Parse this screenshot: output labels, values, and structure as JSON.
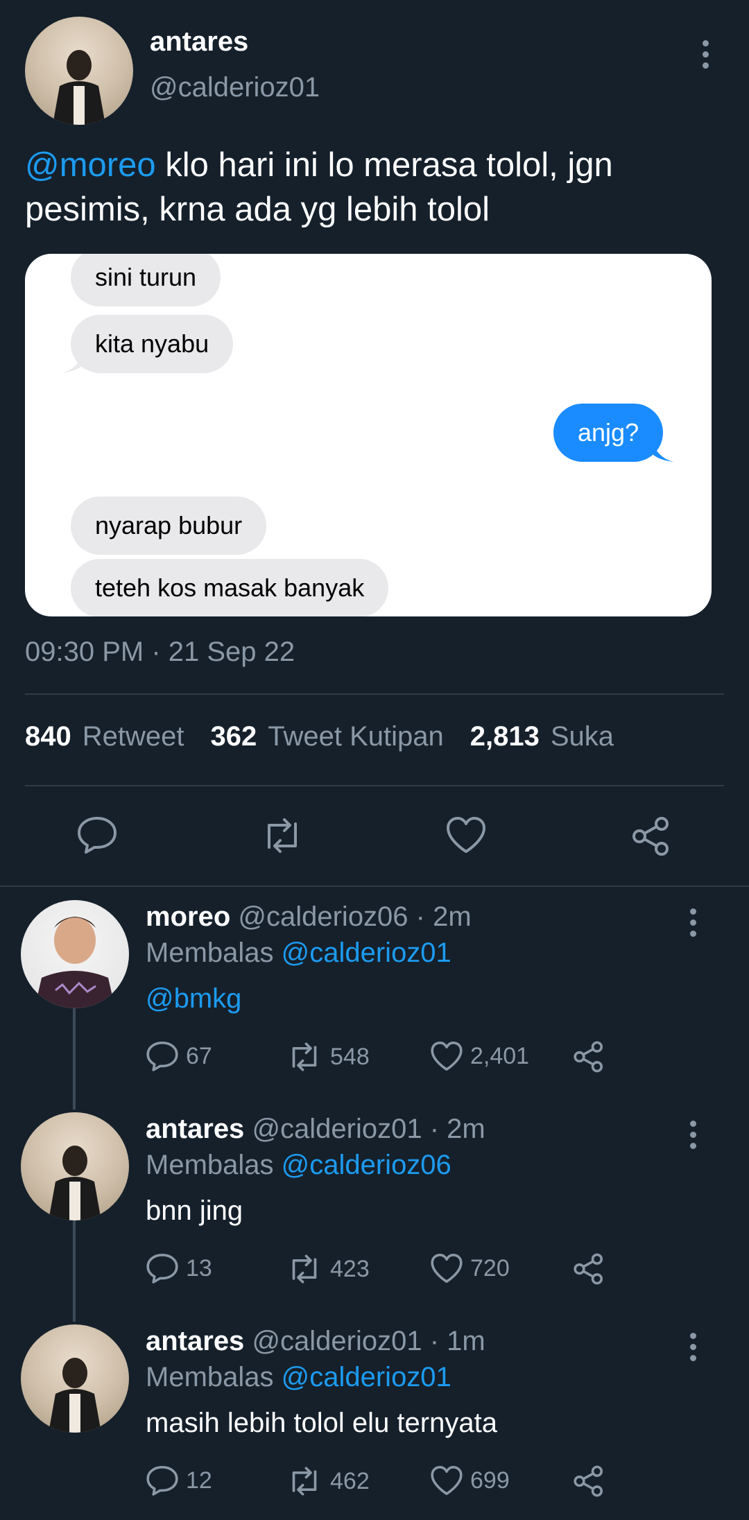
{
  "tweet": {
    "name": "antares",
    "handle": "@calderioz01",
    "mention": "@moreo",
    "text_line1": " klo hari ini lo merasa tolol, jgn",
    "text_line2": "pesimis, krna ada yg lebih tolol",
    "timestamp": "09:30 PM · 21 Sep 22"
  },
  "chat_image": {
    "messages": [
      {
        "side": "in",
        "text": "sini turun"
      },
      {
        "side": "in",
        "text": "kita nyabu"
      },
      {
        "side": "out",
        "text": "anjg?"
      },
      {
        "side": "in",
        "text": "nyarap bubur"
      },
      {
        "side": "in",
        "text": "teteh kos masak banyak"
      }
    ]
  },
  "stats": {
    "retweets": "840",
    "retweets_label": "Retweet",
    "quotes": "362",
    "quotes_label": "Tweet Kutipan",
    "likes": "2,813",
    "likes_label": "Suka"
  },
  "replies": [
    {
      "name": "moreo",
      "handle": "@calderioz06",
      "time": " · 2m",
      "replying_label": "Membalas ",
      "replying_to": "@calderioz01",
      "body": "@bmkg",
      "body_is_link": true,
      "comments": "67",
      "retweets": "548",
      "likes": "2,401"
    },
    {
      "name": "antares",
      "handle": "@calderioz01",
      "time": " · 2m",
      "replying_label": "Membalas ",
      "replying_to": "@calderioz06",
      "body": "bnn jing",
      "body_is_link": false,
      "comments": "13",
      "retweets": "423",
      "likes": "720"
    },
    {
      "name": "antares",
      "handle": "@calderioz01",
      "time": " · 1m",
      "replying_label": "Membalas ",
      "replying_to": "@calderioz01",
      "body": "masih lebih tolol elu ternyata",
      "body_is_link": false,
      "comments": "12",
      "retweets": "462",
      "likes": "699"
    }
  ],
  "icons": {
    "reply": "speech-bubble-icon",
    "retweet": "retweet-arrows-icon",
    "like": "heart-outline-icon",
    "share": "share-nodes-icon",
    "more": "vertical-dots-icon"
  },
  "colors": {
    "background": "#15202b",
    "link": "#1d9bf0",
    "muted": "#8b98a5",
    "bubble_out": "#1a8cff",
    "bubble_in": "#e9e9eb"
  }
}
